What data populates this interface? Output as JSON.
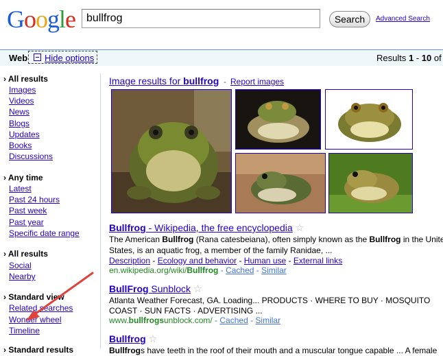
{
  "header": {
    "logo_letters": [
      {
        "ch": "G",
        "color": "#1a5bd8"
      },
      {
        "ch": "o",
        "color": "#d62d20"
      },
      {
        "ch": "o",
        "color": "#e7a711"
      },
      {
        "ch": "g",
        "color": "#1a5bd8"
      },
      {
        "ch": "l",
        "color": "#2c9e3b"
      },
      {
        "ch": "e",
        "color": "#d62d20"
      }
    ],
    "search_value": "bullfrog",
    "search_button": "Search",
    "advanced_search": "Advanced Search"
  },
  "bar": {
    "web": "Web",
    "hide_options": "Hide options",
    "results_prefix": "Results ",
    "results_range_start": "1",
    "results_sep": " - ",
    "results_range_end": "10",
    "results_suffix": " of a"
  },
  "sidebar": {
    "group1_title": "All results",
    "group1": [
      "Images",
      "Videos",
      "News",
      "Blogs",
      "Updates",
      "Books",
      "Discussions"
    ],
    "group2_title": "Any time",
    "group2": [
      "Latest",
      "Past 24 hours",
      "Past week",
      "Past year",
      "Specific date range"
    ],
    "group3_title": "All results",
    "group3": [
      "Social",
      "Nearby"
    ],
    "group4_title": "Standard view",
    "group4": [
      "Related searches",
      "Wonder wheel",
      "Timeline"
    ],
    "group5_title": "Standard results"
  },
  "images": {
    "title_prefix": "Image results for ",
    "title_term": "bullfrog",
    "sep": " - ",
    "report": "Report images"
  },
  "results": [
    {
      "title_bold": "Bullfrog",
      "title_rest": " - Wikipedia, the free encyclopedia",
      "snippet_1a": "The American ",
      "snippet_1b": "Bullfrog",
      "snippet_1c": " (Rana catesbeiana), often simply known as the ",
      "snippet_1d": "Bullfrog",
      "snippet_1e": " in the United",
      "snippet_2": "States, is an aquatic frog, a member of the family Ranidae, ...",
      "links": [
        "Description",
        "Ecology and behavior",
        "Human use",
        "External links"
      ],
      "url_a": "en.wikipedia.org/wiki/",
      "url_b": "Bullfrog",
      "cached": "Cached",
      "similar": "Similar"
    },
    {
      "title_bold": "BullFrog",
      "title_rest": " Sunblock",
      "snippet_1": "Atlanta Weather Forecast, GA. Loading... PRODUCTS · WHERE TO BUY · MOSQUITO",
      "snippet_2": "COAST · SUN FACTS · ADVERTISING ...",
      "url_a": "www.",
      "url_b": "bullfrogs",
      "url_c": "unblock.com/",
      "cached": "Cached",
      "similar": "Similar"
    },
    {
      "title_bold": "Bullfrog",
      "snippet_1a": "Bullfrog",
      "snippet_1b": "s have teeth in the roof of their mouth and a muscular tongue capable ... A female"
    }
  ],
  "colors": {
    "link": "#2200cc",
    "url": "#228822",
    "arrow": "#e0423c",
    "bar_bg": "#f0f7f9",
    "bar_border": "#6b90da"
  }
}
